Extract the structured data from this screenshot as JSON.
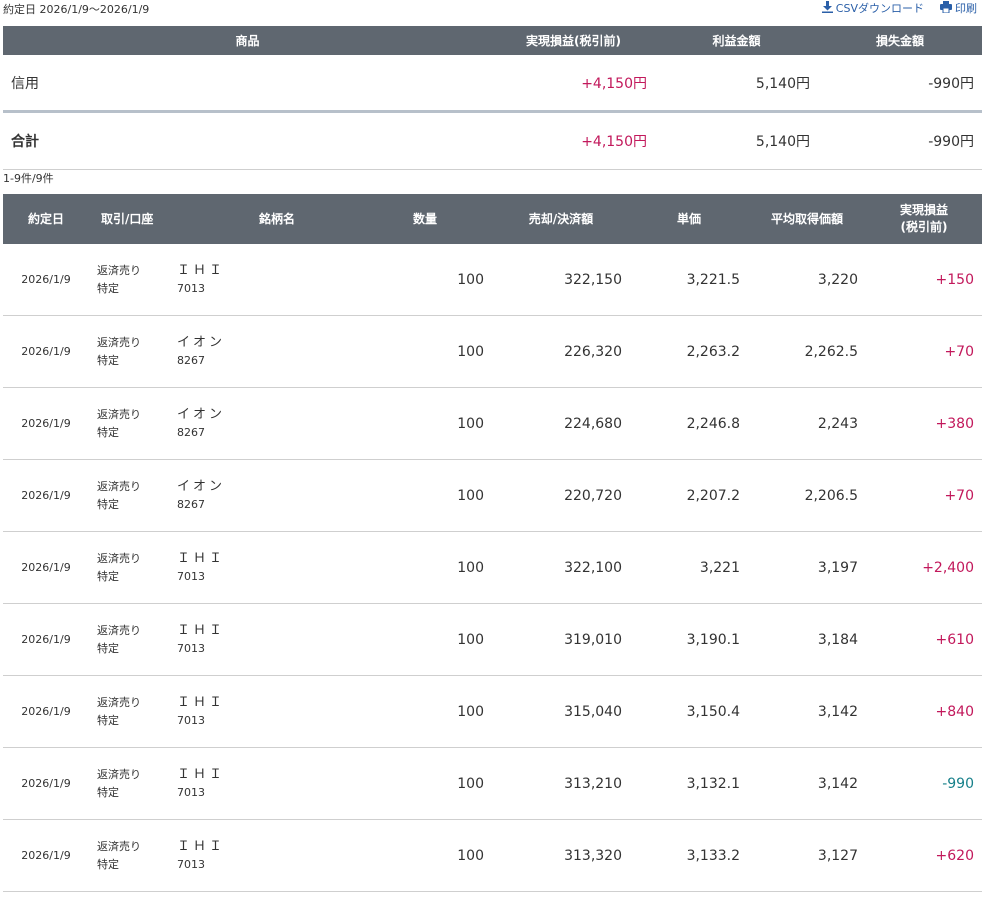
{
  "header": {
    "period": "約定日 2026/1/9〜2026/1/9",
    "csv_label": "CSVダウンロード",
    "print_label": "印刷",
    "icons": [
      "download-icon",
      "printer-icon"
    ],
    "link_color": "#2a5fa8"
  },
  "summary": {
    "columns": [
      "商品",
      "実現損益(税引前)",
      "利益金額",
      "損失金額"
    ],
    "rows": [
      {
        "label": "信用",
        "realized": "+4,150円",
        "profit": "5,140円",
        "loss": "-990円"
      },
      {
        "label": "合計",
        "realized": "+4,150円",
        "profit": "5,140円",
        "loss": "-990円"
      }
    ]
  },
  "count_text": "1-9件/9件",
  "detail": {
    "columns": [
      "約定日",
      "取引/口座",
      "銘柄名",
      "数量",
      "売却/決済額",
      "単価",
      "平均取得価額",
      "実現損益",
      "(税引前)"
    ],
    "rows": [
      {
        "date": "2026/1/9",
        "trade": "返済売り",
        "account": "特定",
        "name": "ＩＨＩ",
        "code": "7013",
        "qty": "100",
        "amount": "322,150",
        "price": "3,221.5",
        "avg": "3,220",
        "pl": "+150"
      },
      {
        "date": "2026/1/9",
        "trade": "返済売り",
        "account": "特定",
        "name": "イオン",
        "code": "8267",
        "qty": "100",
        "amount": "226,320",
        "price": "2,263.2",
        "avg": "2,262.5",
        "pl": "+70"
      },
      {
        "date": "2026/1/9",
        "trade": "返済売り",
        "account": "特定",
        "name": "イオン",
        "code": "8267",
        "qty": "100",
        "amount": "224,680",
        "price": "2,246.8",
        "avg": "2,243",
        "pl": "+380"
      },
      {
        "date": "2026/1/9",
        "trade": "返済売り",
        "account": "特定",
        "name": "イオン",
        "code": "8267",
        "qty": "100",
        "amount": "220,720",
        "price": "2,207.2",
        "avg": "2,206.5",
        "pl": "+70"
      },
      {
        "date": "2026/1/9",
        "trade": "返済売り",
        "account": "特定",
        "name": "ＩＨＩ",
        "code": "7013",
        "qty": "100",
        "amount": "322,100",
        "price": "3,221",
        "avg": "3,197",
        "pl": "+2,400"
      },
      {
        "date": "2026/1/9",
        "trade": "返済売り",
        "account": "特定",
        "name": "ＩＨＩ",
        "code": "7013",
        "qty": "100",
        "amount": "319,010",
        "price": "3,190.1",
        "avg": "3,184",
        "pl": "+610"
      },
      {
        "date": "2026/1/9",
        "trade": "返済売り",
        "account": "特定",
        "name": "ＩＨＩ",
        "code": "7013",
        "qty": "100",
        "amount": "315,040",
        "price": "3,150.4",
        "avg": "3,142",
        "pl": "+840"
      },
      {
        "date": "2026/1/9",
        "trade": "返済売り",
        "account": "特定",
        "name": "ＩＨＩ",
        "code": "7013",
        "qty": "100",
        "amount": "313,210",
        "price": "3,132.1",
        "avg": "3,142",
        "pl": "-990"
      },
      {
        "date": "2026/1/9",
        "trade": "返済売り",
        "account": "特定",
        "name": "ＩＨＩ",
        "code": "7013",
        "qty": "100",
        "amount": "313,320",
        "price": "3,133.2",
        "avg": "3,127",
        "pl": "+620"
      }
    ]
  },
  "colors": {
    "header_bg": "#5f6770",
    "positive": "#c2185b",
    "negative": "#17808a",
    "summary_divider": "#b7c0ca"
  }
}
